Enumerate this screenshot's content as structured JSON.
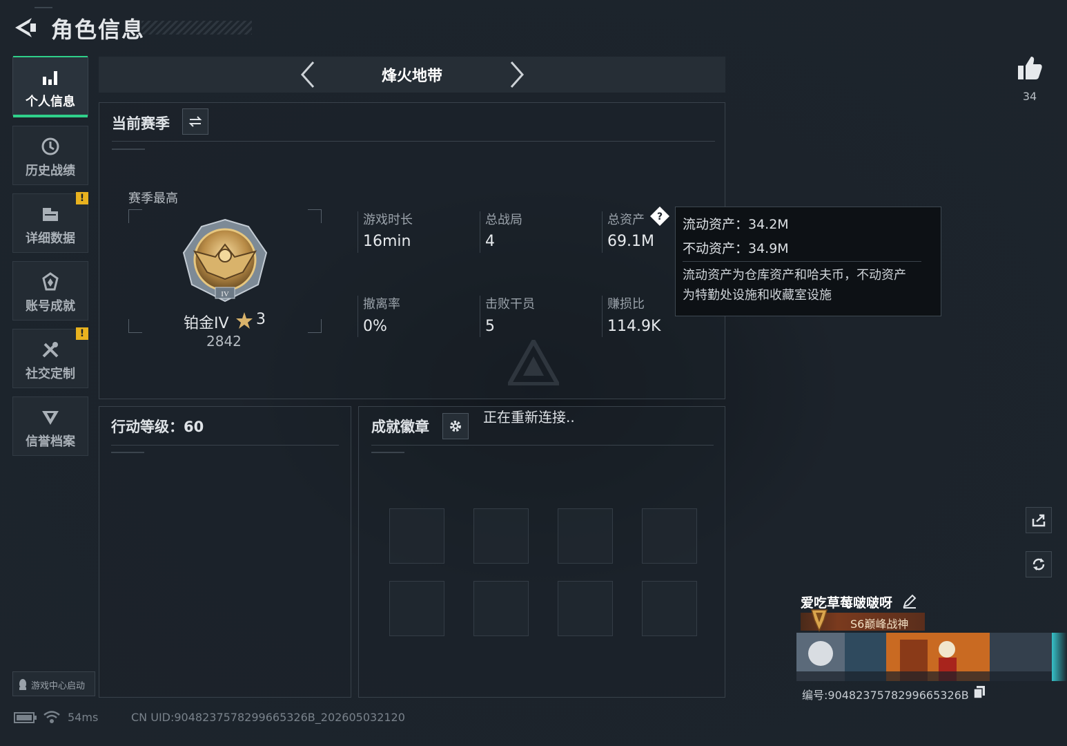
{
  "header": {
    "title": "角色信息"
  },
  "sidebar": {
    "items": [
      {
        "label": "个人信息",
        "icon": "bar-chart-icon",
        "active": true
      },
      {
        "label": "历史战绩",
        "icon": "history-icon"
      },
      {
        "label": "详细数据",
        "icon": "folder-icon",
        "alert": "!"
      },
      {
        "label": "账号成就",
        "icon": "achievement-icon"
      },
      {
        "label": "社交定制",
        "icon": "tools-icon",
        "alert": "!"
      },
      {
        "label": "信誉档案",
        "icon": "reputation-shield-icon"
      }
    ],
    "game_center": "游戏中心启动"
  },
  "mode": {
    "title": "烽火地带"
  },
  "season": {
    "title": "当前赛季",
    "best_label": "赛季最高",
    "rank_name": "铂金IV",
    "stars": "3",
    "rank_score": "2842",
    "rank_numeral": "IV",
    "stats": [
      {
        "label": "游戏时长",
        "value": "16min"
      },
      {
        "label": "总战局",
        "value": "4"
      },
      {
        "label": "总资产",
        "value": "69.1M"
      },
      {
        "label": "撤离率",
        "value": "0%"
      },
      {
        "label": "击败干员",
        "value": "5"
      },
      {
        "label": "赚损比",
        "value": "114.9K"
      }
    ]
  },
  "tooltip": {
    "liquid": "流动资产：34.2M",
    "fixed": "不动资产：34.9M",
    "desc1": "流动资产为仓库资产和哈夫币，不动资产",
    "desc2": "为特勤处设施和收藏室设施"
  },
  "action_level": {
    "title": "行动等级：60"
  },
  "badges": {
    "title": "成就徽章",
    "reconnect": "正在重新连接.."
  },
  "likes": {
    "count": "34"
  },
  "profile": {
    "name": "爱吃草莓啵啵呀",
    "title_badge": "S6巅峰战神",
    "id_text": "编号:9048237578299665326B"
  },
  "status_bar": {
    "ping": "54ms",
    "uid": "CN UID:9048237578299665326B_202605032120"
  },
  "colors": {
    "accent": "#2fd08a",
    "alert": "#e8b21f",
    "background": "#1b222a"
  }
}
